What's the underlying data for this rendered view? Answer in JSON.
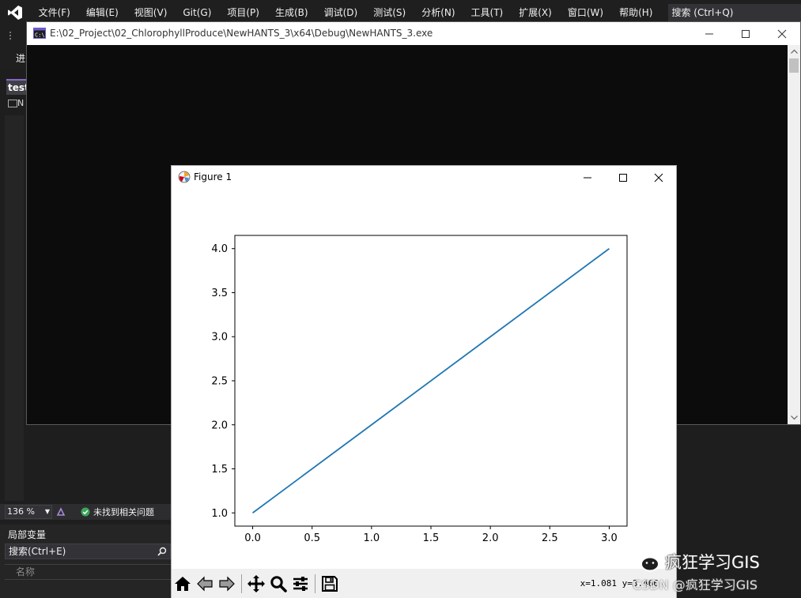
{
  "vs": {
    "menu": [
      "文件(F)",
      "编辑(E)",
      "视图(V)",
      "Git(G)",
      "项目(P)",
      "生成(B)",
      "调试(D)",
      "测试(S)",
      "分析(N)",
      "工具(T)",
      "扩展(X)",
      "窗口(W)",
      "帮助(H)"
    ],
    "search_label": "搜索 (Ctrl+Q)",
    "toolbar_partial_label": "进",
    "doc_tab": "test",
    "doc_subrow": "N",
    "zoom_level": "136 %",
    "issues_text": "未找到相关问题",
    "locals": {
      "title": "局部变量",
      "search_placeholder": "搜索(Ctrl+E)",
      "column_name": "名称"
    }
  },
  "console": {
    "title": "E:\\02_Project\\02_ChlorophyllProduce\\NewHANTS_3\\x64\\Debug\\NewHANTS_3.exe",
    "icon": "console-app-icon"
  },
  "figure": {
    "title": "Figure 1",
    "icon": "matplotlib-icon",
    "toolbar_icons": [
      "home-icon",
      "back-icon",
      "forward-icon",
      "pan-icon",
      "zoom-icon",
      "configure-subplots-icon",
      "save-icon"
    ],
    "coord_readout": "x=1.081  y=3.466"
  },
  "chart_data": {
    "type": "line",
    "title": "",
    "xlabel": "",
    "ylabel": "",
    "x": [
      0.0,
      1.0,
      2.0,
      3.0
    ],
    "series": [
      {
        "values": [
          1.0,
          2.0,
          3.0,
          4.0
        ],
        "color": "#1f77b4"
      }
    ],
    "xlim": [
      -0.15,
      3.15
    ],
    "ylim": [
      0.85,
      4.15
    ],
    "xticks": [
      0.0,
      0.5,
      1.0,
      1.5,
      2.0,
      2.5,
      3.0
    ],
    "yticks": [
      1.0,
      1.5,
      2.0,
      2.5,
      3.0,
      3.5,
      4.0
    ],
    "xtick_labels": [
      "0.0",
      "0.5",
      "1.0",
      "1.5",
      "2.0",
      "2.5",
      "3.0"
    ],
    "ytick_labels": [
      "1.0",
      "1.5",
      "2.0",
      "2.5",
      "3.0",
      "3.5",
      "4.0"
    ],
    "grid": false,
    "legend": "none"
  },
  "watermark": {
    "main": "疯狂学习GIS",
    "sub": "CSDN @疯狂学习GIS"
  }
}
